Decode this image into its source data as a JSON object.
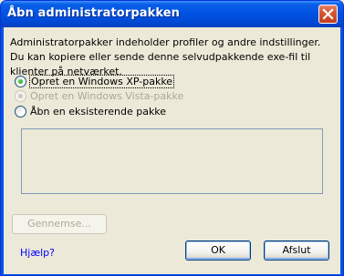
{
  "window": {
    "title": "Åbn administratorpakken"
  },
  "description": "Administratorpakker indeholder profiler og andre indstillinger. Du kan kopiere eller sende denne selvudpakkende exe-fil til klienter på netværket.",
  "options": [
    {
      "label": "Opret en Windows XP-pakke",
      "checked": true,
      "enabled": true
    },
    {
      "label": "Opret en Windows Vista-pakke",
      "checked": true,
      "enabled": false
    },
    {
      "label": "Åbn en eksisterende pakke",
      "checked": false,
      "enabled": true
    }
  ],
  "buttons": {
    "browse": "Gennemse...",
    "ok": "OK",
    "cancel": "Afslut"
  },
  "help_link": "Hjælp?",
  "colors": {
    "titlebar": "#0054e3",
    "dialog_bg": "#ece9d8",
    "close_button": "#d5532f",
    "link": "#0000ff",
    "radio_dot": "#21a121"
  }
}
